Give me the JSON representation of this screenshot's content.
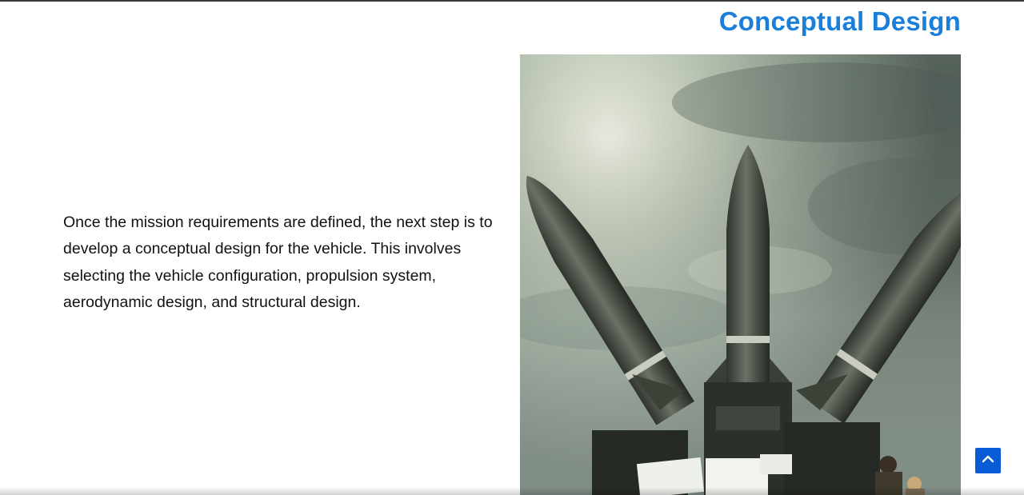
{
  "section": {
    "title": "Conceptual Design",
    "body": "Once the mission requirements are defined, the next step is to develop a conceptual design for the vehicle. This involves selecting the vehicle configuration, propulsion system, aerodynamic design, and structural design."
  },
  "image": {
    "subject": "three surface-to-air missiles on a launcher against a cloudy sky"
  },
  "scroll_top": {
    "icon": "chevron-up-icon"
  },
  "colors": {
    "title": "#1a7fd9",
    "scroll_button": "#0a5bd6",
    "text": "#111111"
  }
}
